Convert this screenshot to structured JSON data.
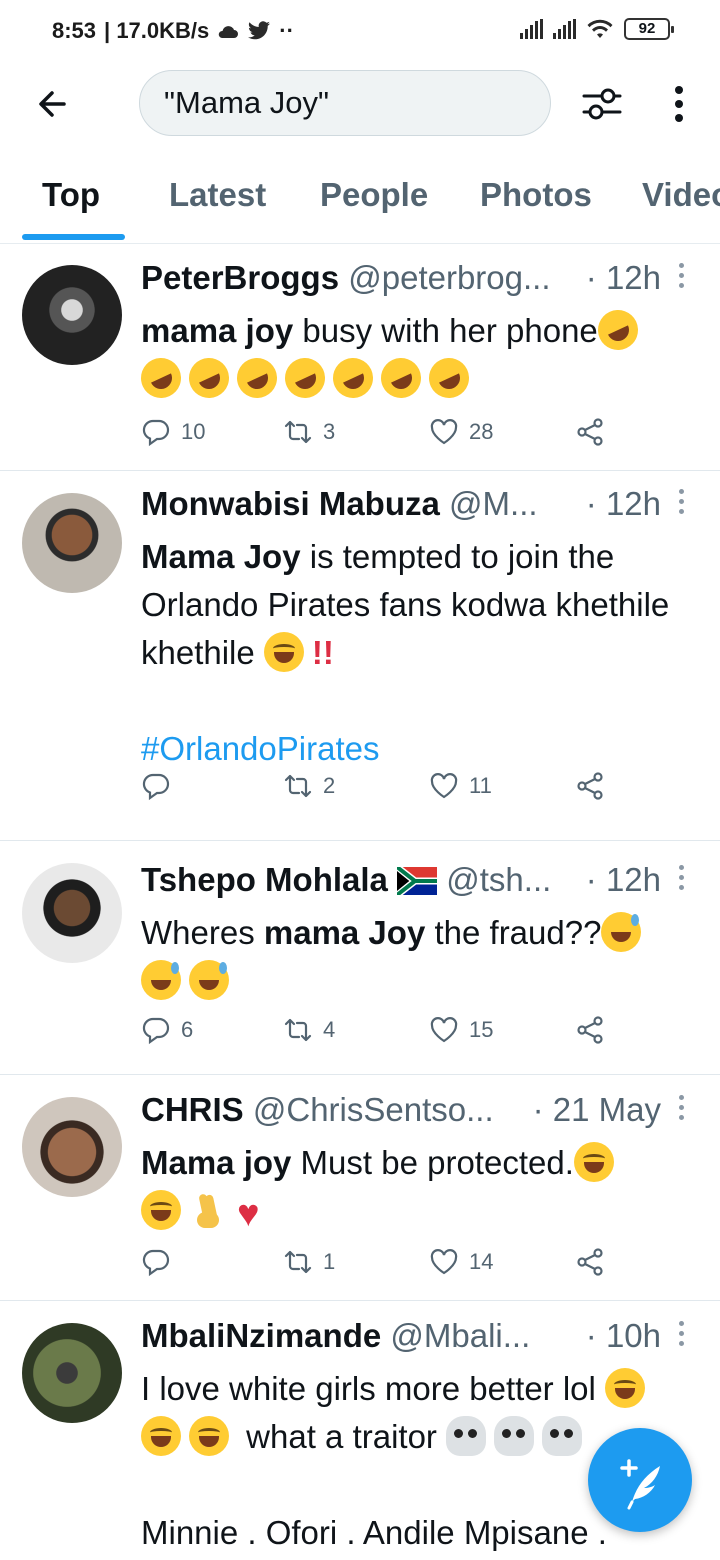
{
  "status_bar": {
    "time": "8:53",
    "speed": "| 17.0KB/s",
    "battery": "92"
  },
  "search": {
    "query": "\"Mama Joy\""
  },
  "tabs": [
    "Top",
    "Latest",
    "People",
    "Photos",
    "Videos"
  ],
  "tweets": [
    {
      "name": "PeterBroggs",
      "handle": "@peterbrog...",
      "time": "· 12h",
      "text_bold": "mama joy",
      "text": " busy with her phone",
      "replies": "10",
      "retweets": "3",
      "likes": "28"
    },
    {
      "name": "Monwabisi Mabuza",
      "handle": "@M...",
      "time": "· 12h",
      "text_bold": "Mama Joy",
      "text": " is tempted to join the Orlando Pirates fans kodwa khethile khethile",
      "exclaim": "!!",
      "hashtag": "#OrlandoPirates",
      "replies": "",
      "retweets": "2",
      "likes": "11"
    },
    {
      "name": "Tshepo Mohlala",
      "handle": "@tsh...",
      "time": "· 12h",
      "text_pre": "Wheres ",
      "text_bold": "mama Joy",
      "text": " the fraud??",
      "replies": "6",
      "retweets": "4",
      "likes": "15"
    },
    {
      "name": "CHRIS",
      "handle": "@ChrisSentso...",
      "time": "· 21 May",
      "text_bold": "Mama joy",
      "text": " Must be protected.",
      "heart": "♥",
      "replies": "",
      "retweets": "1",
      "likes": "14"
    },
    {
      "name": "MbaliNzimande",
      "handle": "@Mbali...",
      "time": "· 10h",
      "text_line1": "I love white girls more better lol ",
      "text_line2": " what a traitor ",
      "text_line3": "Minnie . Ofori . Andile Mpisane ."
    }
  ]
}
